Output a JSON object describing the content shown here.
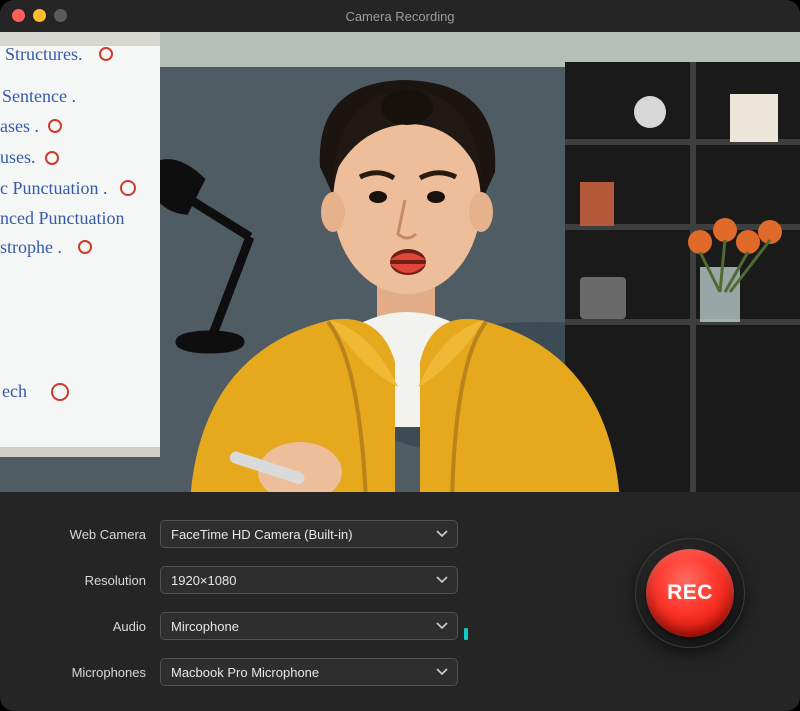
{
  "window": {
    "title": "Camera Recording"
  },
  "form": {
    "webcam": {
      "label": "Web Camera",
      "value": "FaceTime HD Camera (Built-in)"
    },
    "resolution": {
      "label": "Resolution",
      "value": "1920×1080"
    },
    "audio": {
      "label": "Audio",
      "value": "Mircophone"
    },
    "mic": {
      "label": "Microphones",
      "value": "Macbook Pro Microphone"
    }
  },
  "rec": {
    "label": "REC"
  },
  "whiteboard": {
    "l1": "Structures.",
    "l2": "Sentence .",
    "l3": "ases .",
    "l4": "uses.",
    "l5": "c Punctuation .",
    "l6": "nced  Punctuation",
    "l7": "strophe .",
    "l8": "ech"
  },
  "colors": {
    "accent": "#17c7c1",
    "rec": "#ff3a2f"
  }
}
